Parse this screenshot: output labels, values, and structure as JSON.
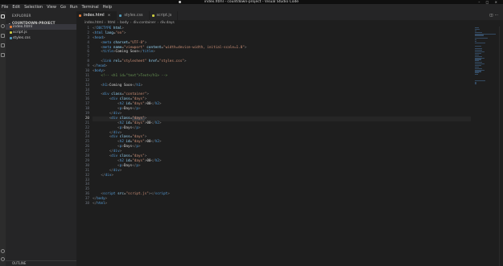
{
  "window": {
    "title": "index.html - countdown-project - Visual Studio Code"
  },
  "menu": [
    "File",
    "Edit",
    "Selection",
    "View",
    "Go",
    "Run",
    "Terminal",
    "Help"
  ],
  "sidebar": {
    "header": "EXPLORER",
    "project": "COUNTDOWN-PROJECT",
    "files": [
      {
        "name": "index.html",
        "icon_color": "#e37933",
        "selected": true
      },
      {
        "name": "script.js",
        "icon_color": "#cbcb41",
        "selected": false
      },
      {
        "name": "styles.css",
        "icon_color": "#519aba",
        "selected": false
      }
    ],
    "outline": "OUTLINE"
  },
  "tabs": [
    {
      "label": "index.html",
      "icon_color": "#e37933",
      "active": true
    },
    {
      "label": "styles.css",
      "icon_color": "#519aba",
      "active": false
    },
    {
      "label": "script.js",
      "icon_color": "#cbcb41",
      "active": false
    }
  ],
  "breadcrumb": [
    "index.html",
    "html",
    "body",
    "div.container",
    "div.days"
  ],
  "editor": {
    "current_line": 20,
    "lines": [
      [
        [
          "c-brk",
          "<!"
        ],
        [
          "c-tag",
          "DOCTYPE"
        ],
        [
          "c-attr",
          " html"
        ],
        [
          "c-brk",
          ">"
        ]
      ],
      [
        [
          "c-brk",
          "<"
        ],
        [
          "c-tag",
          "html"
        ],
        [
          "c-attr",
          " lang"
        ],
        [
          "c-txt",
          "="
        ],
        [
          "c-str",
          "\"en\""
        ],
        [
          "c-brk",
          ">"
        ]
      ],
      [
        [
          "c-brk",
          "<"
        ],
        [
          "c-tag",
          "head"
        ],
        [
          "c-brk",
          ">"
        ]
      ],
      [
        [
          "c-txt",
          "    "
        ],
        [
          "c-brk",
          "<"
        ],
        [
          "c-tag",
          "meta"
        ],
        [
          "c-attr",
          " charset"
        ],
        [
          "c-txt",
          "="
        ],
        [
          "c-str",
          "\"UTF-8\""
        ],
        [
          "c-brk",
          ">"
        ]
      ],
      [
        [
          "c-txt",
          "    "
        ],
        [
          "c-brk",
          "<"
        ],
        [
          "c-tag",
          "meta"
        ],
        [
          "c-attr",
          " name"
        ],
        [
          "c-txt",
          "="
        ],
        [
          "c-str",
          "\"viewport\""
        ],
        [
          "c-attr",
          " content"
        ],
        [
          "c-txt",
          "="
        ],
        [
          "c-str",
          "\"width=device-width, initial-scale=1.0\""
        ],
        [
          "c-brk",
          ">"
        ]
      ],
      [
        [
          "c-txt",
          "    "
        ],
        [
          "c-brk",
          "<"
        ],
        [
          "c-tag",
          "title"
        ],
        [
          "c-brk",
          ">"
        ],
        [
          "c-txt",
          "Coming Soon"
        ],
        [
          "c-brk",
          "</"
        ],
        [
          "c-tag",
          "title"
        ],
        [
          "c-brk",
          ">"
        ]
      ],
      [],
      [
        [
          "c-txt",
          "    "
        ],
        [
          "c-brk",
          "<"
        ],
        [
          "c-tag",
          "link"
        ],
        [
          "c-attr",
          " rel"
        ],
        [
          "c-txt",
          "="
        ],
        [
          "c-str",
          "\"stylesheet\""
        ],
        [
          "c-attr",
          " href"
        ],
        [
          "c-txt",
          "="
        ],
        [
          "c-str",
          "\"styles.css\""
        ],
        [
          "c-brk",
          ">"
        ]
      ],
      [
        [
          "c-brk",
          "</"
        ],
        [
          "c-tag",
          "head"
        ],
        [
          "c-brk",
          ">"
        ]
      ],
      [
        [
          "c-brk",
          "<"
        ],
        [
          "c-tag",
          "body"
        ],
        [
          "c-brk",
          ">"
        ]
      ],
      [
        [
          "c-com",
          "    <!-- <h1 id=\"text\">Text</h1> -->"
        ]
      ],
      [],
      [
        [
          "c-txt",
          "    "
        ],
        [
          "c-brk",
          "<"
        ],
        [
          "c-tag",
          "h1"
        ],
        [
          "c-brk",
          ">"
        ],
        [
          "c-txt",
          "Coming Soon"
        ],
        [
          "c-brk",
          "</"
        ],
        [
          "c-tag",
          "h1"
        ],
        [
          "c-brk",
          ">"
        ]
      ],
      [],
      [
        [
          "c-txt",
          "    "
        ],
        [
          "c-brk",
          "<"
        ],
        [
          "c-tag",
          "div"
        ],
        [
          "c-attr",
          " class"
        ],
        [
          "c-txt",
          "="
        ],
        [
          "c-str",
          "\"container\""
        ],
        [
          "c-brk",
          ">"
        ]
      ],
      [
        [
          "c-txt",
          "        "
        ],
        [
          "c-brk",
          "<"
        ],
        [
          "c-tag",
          "div"
        ],
        [
          "c-attr",
          " class"
        ],
        [
          "c-txt",
          "="
        ],
        [
          "c-str",
          "\"days\""
        ],
        [
          "c-brk",
          ">"
        ]
      ],
      [
        [
          "c-txt",
          "            "
        ],
        [
          "c-brk",
          "<"
        ],
        [
          "c-tag",
          "h2"
        ],
        [
          "c-attr",
          " id"
        ],
        [
          "c-txt",
          "="
        ],
        [
          "c-str",
          "\"days\""
        ],
        [
          "c-brk",
          ">"
        ],
        [
          "c-txt",
          "00"
        ],
        [
          "c-brk",
          "</"
        ],
        [
          "c-tag",
          "h2"
        ],
        [
          "c-brk",
          ">"
        ]
      ],
      [
        [
          "c-txt",
          "            "
        ],
        [
          "c-brk",
          "<"
        ],
        [
          "c-tag",
          "p"
        ],
        [
          "c-brk",
          ">"
        ],
        [
          "c-txt",
          "Days"
        ],
        [
          "c-brk",
          "</"
        ],
        [
          "c-tag",
          "p"
        ],
        [
          "c-brk",
          ">"
        ]
      ],
      [
        [
          "c-txt",
          "        "
        ],
        [
          "c-brk",
          "</"
        ],
        [
          "c-tag",
          "div"
        ],
        [
          "c-brk",
          ">"
        ]
      ],
      [
        [
          "c-txt",
          "        "
        ],
        [
          "c-brk",
          "<"
        ],
        [
          "c-tag",
          "div"
        ],
        [
          "c-attr",
          " class"
        ],
        [
          "c-txt",
          "="
        ],
        [
          "c-str",
          "\"days\""
        ],
        [
          "c-brk",
          ">"
        ]
      ],
      [
        [
          "c-txt",
          "            "
        ],
        [
          "c-brk",
          "<"
        ],
        [
          "c-tag",
          "h2"
        ],
        [
          "c-attr",
          " id"
        ],
        [
          "c-txt",
          "="
        ],
        [
          "c-str",
          "\"days\""
        ],
        [
          "c-brk",
          ">"
        ],
        [
          "c-txt",
          "00"
        ],
        [
          "c-brk",
          "</"
        ],
        [
          "c-tag",
          "h2"
        ],
        [
          "c-brk",
          ">"
        ]
      ],
      [
        [
          "c-txt",
          "            "
        ],
        [
          "c-brk",
          "<"
        ],
        [
          "c-tag",
          "p"
        ],
        [
          "c-brk",
          ">"
        ],
        [
          "c-txt",
          "Days"
        ],
        [
          "c-brk",
          "</"
        ],
        [
          "c-tag",
          "p"
        ],
        [
          "c-brk",
          ">"
        ]
      ],
      [
        [
          "c-txt",
          "        "
        ],
        [
          "c-brk",
          "</"
        ],
        [
          "c-tag",
          "div"
        ],
        [
          "c-brk",
          ">"
        ]
      ],
      [
        [
          "c-txt",
          "        "
        ],
        [
          "c-brk",
          "<"
        ],
        [
          "c-tag",
          "div"
        ],
        [
          "c-attr",
          " class"
        ],
        [
          "c-txt",
          "="
        ],
        [
          "c-str",
          "\"days\""
        ],
        [
          "c-brk",
          ">"
        ]
      ],
      [
        [
          "c-txt",
          "            "
        ],
        [
          "c-brk",
          "<"
        ],
        [
          "c-tag",
          "h2"
        ],
        [
          "c-attr",
          " id"
        ],
        [
          "c-txt",
          "="
        ],
        [
          "c-str",
          "\"days\""
        ],
        [
          "c-brk",
          ">"
        ],
        [
          "c-txt",
          "00"
        ],
        [
          "c-brk",
          "</"
        ],
        [
          "c-tag",
          "h2"
        ],
        [
          "c-brk",
          ">"
        ]
      ],
      [
        [
          "c-txt",
          "            "
        ],
        [
          "c-brk",
          "<"
        ],
        [
          "c-tag",
          "p"
        ],
        [
          "c-brk",
          ">"
        ],
        [
          "c-txt",
          "Days"
        ],
        [
          "c-brk",
          "</"
        ],
        [
          "c-tag",
          "p"
        ],
        [
          "c-brk",
          ">"
        ]
      ],
      [
        [
          "c-txt",
          "        "
        ],
        [
          "c-brk",
          "</"
        ],
        [
          "c-tag",
          "div"
        ],
        [
          "c-brk",
          ">"
        ]
      ],
      [
        [
          "c-txt",
          "        "
        ],
        [
          "c-brk",
          "<"
        ],
        [
          "c-tag",
          "div"
        ],
        [
          "c-attr",
          " class"
        ],
        [
          "c-txt",
          "="
        ],
        [
          "c-str",
          "\"days\""
        ],
        [
          "c-brk",
          ">"
        ]
      ],
      [
        [
          "c-txt",
          "            "
        ],
        [
          "c-brk",
          "<"
        ],
        [
          "c-tag",
          "h2"
        ],
        [
          "c-attr",
          " id"
        ],
        [
          "c-txt",
          "="
        ],
        [
          "c-str",
          "\"days\""
        ],
        [
          "c-brk",
          ">"
        ],
        [
          "c-txt",
          "00"
        ],
        [
          "c-brk",
          "</"
        ],
        [
          "c-tag",
          "h2"
        ],
        [
          "c-brk",
          ">"
        ]
      ],
      [
        [
          "c-txt",
          "            "
        ],
        [
          "c-brk",
          "<"
        ],
        [
          "c-tag",
          "p"
        ],
        [
          "c-brk",
          ">"
        ],
        [
          "c-txt",
          "Days"
        ],
        [
          "c-brk",
          "</"
        ],
        [
          "c-tag",
          "p"
        ],
        [
          "c-brk",
          ">"
        ]
      ],
      [
        [
          "c-txt",
          "        "
        ],
        [
          "c-brk",
          "</"
        ],
        [
          "c-tag",
          "div"
        ],
        [
          "c-brk",
          ">"
        ]
      ],
      [
        [
          "c-txt",
          "    "
        ],
        [
          "c-brk",
          "</"
        ],
        [
          "c-tag",
          "div"
        ],
        [
          "c-brk",
          ">"
        ]
      ],
      [],
      [],
      [],
      [
        [
          "c-txt",
          "    "
        ],
        [
          "c-brk",
          "<"
        ],
        [
          "c-tag",
          "script"
        ],
        [
          "c-attr",
          " src"
        ],
        [
          "c-txt",
          "="
        ],
        [
          "c-str",
          "\"script.js\""
        ],
        [
          "c-brk",
          "></"
        ],
        [
          "c-tag",
          "script"
        ],
        [
          "c-brk",
          ">"
        ]
      ],
      [
        [
          "c-brk",
          "</"
        ],
        [
          "c-tag",
          "body"
        ],
        [
          "c-brk",
          ">"
        ]
      ],
      [
        [
          "c-brk",
          "</"
        ],
        [
          "c-tag",
          "html"
        ],
        [
          "c-brk",
          ">"
        ]
      ]
    ]
  }
}
